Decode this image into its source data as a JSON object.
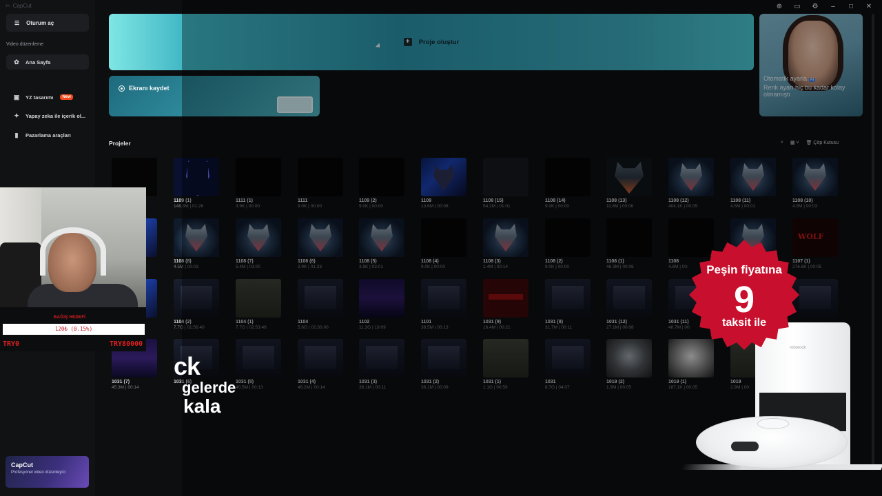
{
  "app": {
    "title": "CapCut"
  },
  "sidebar": {
    "login": "Oturum aç",
    "section": "Video düzenleme",
    "items": [
      {
        "label": "Ana Sayfa",
        "icon": "home-icon"
      },
      {
        "label": "YZ tasarımı",
        "icon": "image-icon",
        "badge": "New"
      },
      {
        "label": "Yapay zeka ile içerik ol...",
        "icon": "sparkle-icon"
      },
      {
        "label": "Pazarlama araçları",
        "icon": "bag-icon"
      }
    ],
    "promo": {
      "title": "CapCut",
      "subtitle": "Profesyonel video düzenleyici"
    }
  },
  "create": {
    "label": "Proje oluştur"
  },
  "record": {
    "label": "Ekranı kaydet"
  },
  "ad": {
    "line1": "Otomatik ayarla",
    "ai": "AI",
    "line2": "Renk ayarı hiç bu kadar kolay olmamıştı"
  },
  "projects": {
    "title": "Projeler",
    "trash": "Çöp Kutusu",
    "rows": [
      [
        {
          "name": "",
          "meta": "",
          "thumb": "th-dark"
        },
        {
          "name": "1109 (1)",
          "meta": "148.3M | 01:26",
          "thumb": "th-neon"
        },
        {
          "name": "1111 (1)",
          "meta": "3.9K | 00:00",
          "thumb": "th-dark"
        },
        {
          "name": "1111",
          "meta": "9.0K | 00:00",
          "thumb": "th-dark"
        },
        {
          "name": "1109 (2)",
          "meta": "9.0K | 00:00",
          "thumb": "th-dark"
        },
        {
          "name": "1109",
          "meta": "13.6M | 00:06",
          "thumb": "th-storm"
        },
        {
          "name": "1108 (15)",
          "meta": "54.2M | 01:01",
          "thumb": "th-dark2"
        },
        {
          "name": "1108 (14)",
          "meta": "9.0K | 00:00",
          "thumb": "th-dark"
        },
        {
          "name": "1108 (13)",
          "meta": "11.6M | 00:06",
          "thumb": "th-fire"
        },
        {
          "name": "1108 (12)",
          "meta": "404.1K | 00:05",
          "thumb": "th-wolf"
        },
        {
          "name": "1108 (11)",
          "meta": "4.5M | 00:01",
          "thumb": "th-wolf"
        },
        {
          "name": "1108 (10)",
          "meta": "4.5M | 00:03",
          "thumb": "th-wolf"
        }
      ],
      [
        {
          "name": "",
          "meta": "",
          "thumb": "th-storm"
        },
        {
          "name": "1108 (8)",
          "meta": "4.5M | 00:03",
          "thumb": "th-wolf"
        },
        {
          "name": "1108 (7)",
          "meta": "5.4M | 01:00",
          "thumb": "th-wolf"
        },
        {
          "name": "1108 (6)",
          "meta": "3.9K | 01:23",
          "thumb": "th-wolf"
        },
        {
          "name": "1108 (5)",
          "meta": "3.9K | 03:01",
          "thumb": "th-wolf"
        },
        {
          "name": "1108 (4)",
          "meta": "9.0K | 00:00",
          "thumb": "th-dark"
        },
        {
          "name": "1108 (3)",
          "meta": "1.4M | 00:14",
          "thumb": "th-wolf"
        },
        {
          "name": "1108 (2)",
          "meta": "9.0K | 00:00",
          "thumb": "th-dark"
        },
        {
          "name": "1108 (1)",
          "meta": "46.3M | 00:06",
          "thumb": "th-dark"
        },
        {
          "name": "1108",
          "meta": "4.6M | 00:",
          "thumb": "th-dark"
        },
        {
          "name": "",
          "meta": "",
          "thumb": "th-wolf"
        },
        {
          "name": "1107 (1)",
          "meta": "276.6K | 00:05",
          "thumb": "th-redwatch"
        }
      ],
      [
        {
          "name": "1107",
          "meta": "",
          "thumb": "th-storm"
        },
        {
          "name": "1104 (2)",
          "meta": "7.7G | 01:56:40",
          "thumb": "th-game"
        },
        {
          "name": "1104 (1)",
          "meta": "7.7G | 02:53:46",
          "thumb": "th-game2"
        },
        {
          "name": "1104",
          "meta": "5.6G | 02:30:00",
          "thumb": "th-game"
        },
        {
          "name": "1102",
          "meta": "11.3G | 19:09",
          "thumb": "th-purple"
        },
        {
          "name": "1101",
          "meta": "38.5M | 00:13",
          "thumb": "th-game"
        },
        {
          "name": "1031 (9)",
          "meta": "16.4M | 00:21",
          "thumb": "th-red"
        },
        {
          "name": "1031 (8)",
          "meta": "31.7M | 00:11",
          "thumb": "th-game"
        },
        {
          "name": "1031 (12)",
          "meta": "27.1M | 00:08",
          "thumb": "th-game"
        },
        {
          "name": "1031 (11)",
          "meta": "48.7M | 00:",
          "thumb": "th-game"
        },
        {
          "name": "",
          "meta": "",
          "thumb": "th-game"
        },
        {
          "name": "",
          "meta": "",
          "thumb": "th-game"
        }
      ],
      [
        {
          "name": "1031 (7)",
          "meta": "45.3M | 00:14",
          "thumb": "th-purple"
        },
        {
          "name": "1031 (6)",
          "meta": "",
          "thumb": "th-game"
        },
        {
          "name": "1031 (5)",
          "meta": "40.5M | 00:13",
          "thumb": "th-game"
        },
        {
          "name": "1031 (4)",
          "meta": "48.2M | 00:14",
          "thumb": "th-game"
        },
        {
          "name": "1031 (3)",
          "meta": "36.1M | 00:11",
          "thumb": "th-game"
        },
        {
          "name": "1031 (2)",
          "meta": "36.1M | 00:09",
          "thumb": "th-game"
        },
        {
          "name": "1031 (1)",
          "meta": "1.1G | 00:59",
          "thumb": "th-game2"
        },
        {
          "name": "1031",
          "meta": "6.7G | 04:07",
          "thumb": "th-game"
        },
        {
          "name": "1019 (2)",
          "meta": "1.9M | 00:05",
          "thumb": "th-gray"
        },
        {
          "name": "1019 (1)",
          "meta": "187.1K | 00:05",
          "thumb": "th-white"
        },
        {
          "name": "1019",
          "meta": "2.9M | 00:",
          "thumb": "th-game2"
        },
        {
          "name": "",
          "meta": "",
          "thumb": "th-dark"
        }
      ]
    ]
  },
  "stream": {
    "donate_title": "BAĞIŞ HEDEFİ",
    "donate_bar": "120₺ (0.15%)",
    "donate_left": "TRY0",
    "donate_right": "TRY80000"
  },
  "overlay_text": {
    "l1": "ck",
    "l2": "gelerde",
    "l3": "kala"
  },
  "ad_badge": {
    "line1": "Peşin fiyatına",
    "big": "9",
    "line3": "taksit ile",
    "color": "#c8102e"
  },
  "robot_brand": "roborock",
  "colors": {
    "accent": "#3aa4b6",
    "new_badge": "#f04a1d"
  }
}
